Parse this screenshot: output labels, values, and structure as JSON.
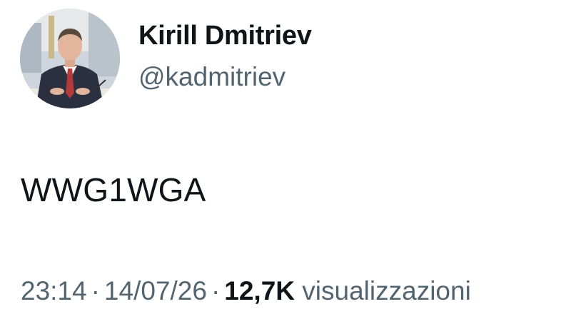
{
  "author": {
    "display_name": "Kirill Dmitriev",
    "handle": "@kadmitriev"
  },
  "tweet": {
    "text": "WWG1WGA",
    "time": "23:14",
    "separator": "·",
    "date": "14/07/26",
    "views_count": "12,7K",
    "views_label": "visualizzazioni"
  },
  "colors": {
    "primary_text": "#0f1419",
    "secondary_text": "#536471",
    "background": "#ffffff"
  }
}
